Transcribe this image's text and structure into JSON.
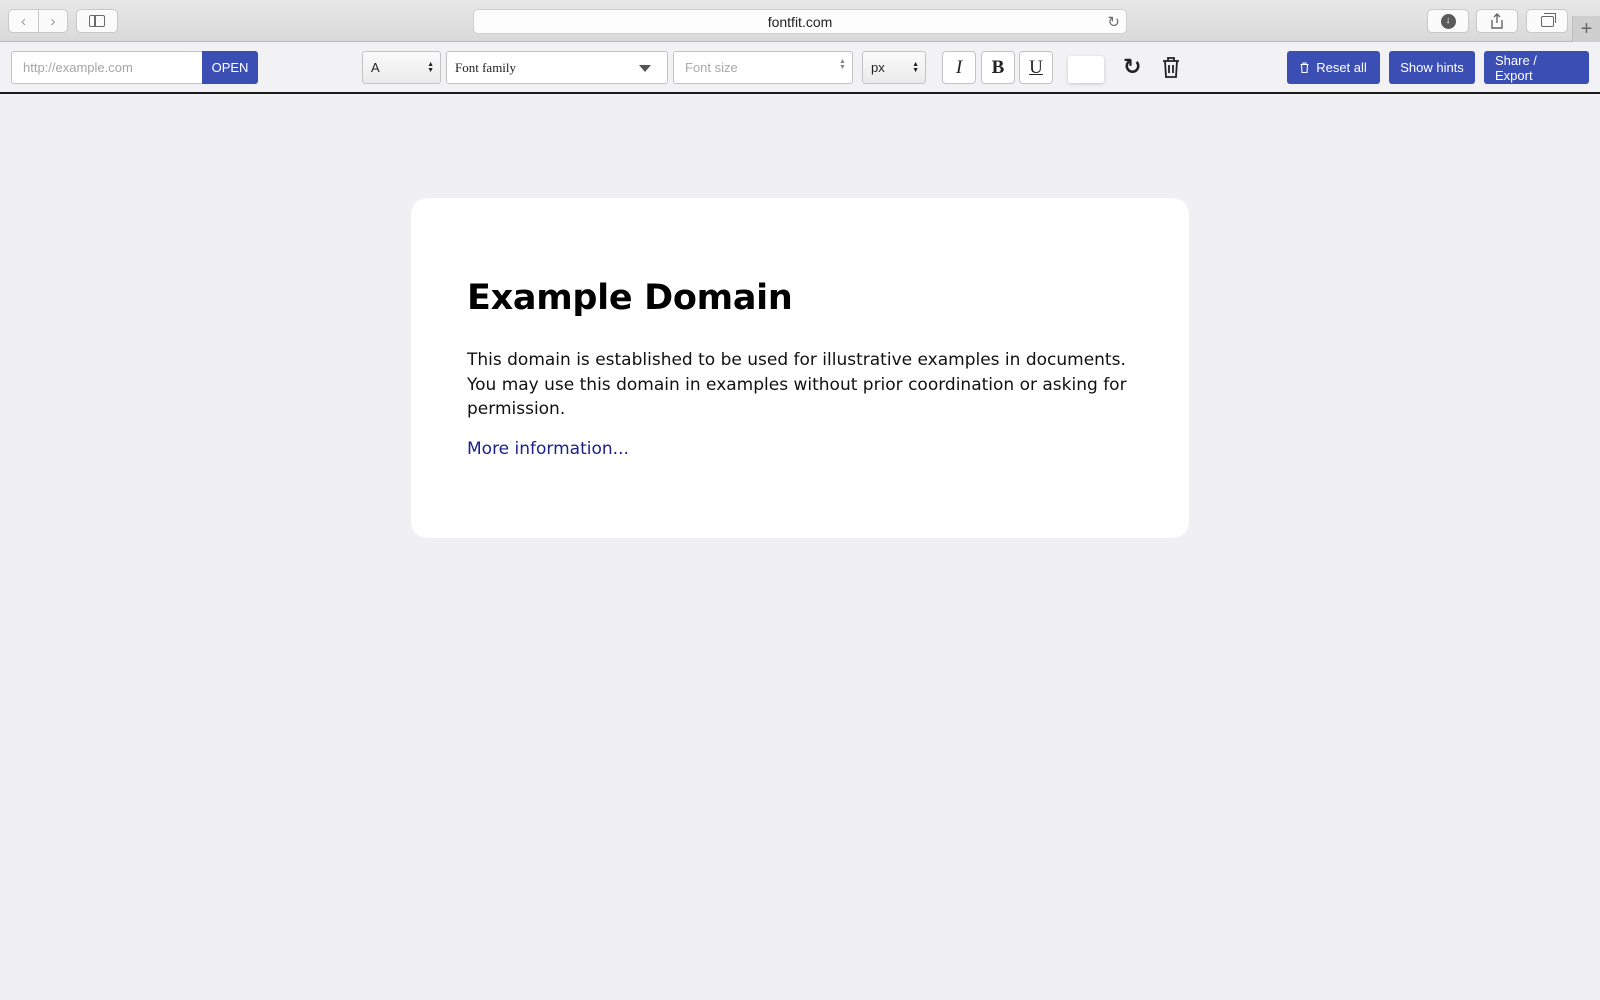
{
  "browser": {
    "address": "fontfit.com",
    "icons": {
      "back": "chevron-left-icon",
      "forward": "chevron-right-icon",
      "sidebar": "sidebar-icon",
      "reload": "reload-icon",
      "downloads": "download-icon",
      "share": "share-icon",
      "tabs": "tabs-icon",
      "new_tab": "plus-icon"
    }
  },
  "toolbar": {
    "url_placeholder": "http://example.com",
    "open_label": "OPEN",
    "element_select": "A",
    "font_family_placeholder": "Font family",
    "font_size_placeholder": "Font size",
    "unit_select": "px",
    "italic_label": "I",
    "bold_label": "B",
    "underline_label": "U",
    "color_value": "#ffffff",
    "reset_all_label": "Reset all",
    "show_hints_label": "Show hints",
    "share_export_label": "Share / Export",
    "accent_color": "#3b4eb4"
  },
  "page": {
    "title": "Example Domain",
    "paragraph": "This domain is established to be used for illustrative examples in documents. You may use this domain in examples without prior coordination or asking for permission.",
    "link": "More information..."
  }
}
